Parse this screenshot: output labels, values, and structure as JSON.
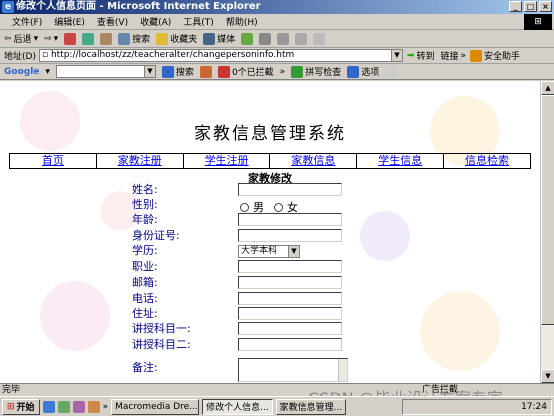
{
  "window": {
    "title": "修改个人信息页面 - Microsoft Internet Explorer",
    "min": "_",
    "max": "□",
    "close": "×"
  },
  "menu": [
    "文件(F)",
    "编辑(E)",
    "查看(V)",
    "收藏(A)",
    "工具(T)",
    "帮助(H)"
  ],
  "toolbar": {
    "back": "后退",
    "search": "搜索",
    "favorites": "收藏夹",
    "media": "媒体"
  },
  "address": {
    "label": "地址(D)",
    "url": "http://localhost/zz/teacheralter/changepersoninfo.htm",
    "go": "转到",
    "links": "链接",
    "security": "安全助手"
  },
  "google": {
    "logo": "Google",
    "search": "搜索",
    "blocked": "0个已拦截",
    "spell": "拼写检查",
    "options": "选项"
  },
  "page": {
    "title": "家教信息管理系统",
    "nav": [
      "首页",
      "家教注册",
      "学生注册",
      "家教信息",
      "学生信息",
      "信息检索"
    ],
    "form_title": "家教修改",
    "fields": {
      "name": "姓名:",
      "gender": "性别:",
      "male": "男",
      "female": "女",
      "age": "年龄:",
      "id_card": "身份证号:",
      "education": "学历:",
      "education_value": "大学本科",
      "job": "职业:",
      "email": "邮箱:",
      "phone": "电话:",
      "address": "住址:",
      "subject1": "讲授科目一:",
      "subject2": "讲授科目二:",
      "note": "备注:"
    }
  },
  "status": {
    "text": "完毕",
    "ad": "广告拦截"
  },
  "taskbar": {
    "start": "开始",
    "tasks": [
      "Macromedia Dre...",
      "修改个人信息...",
      "家教信息管理..."
    ],
    "time": "17:24"
  },
  "watermark": "CSDN @毕业设计方案专家"
}
